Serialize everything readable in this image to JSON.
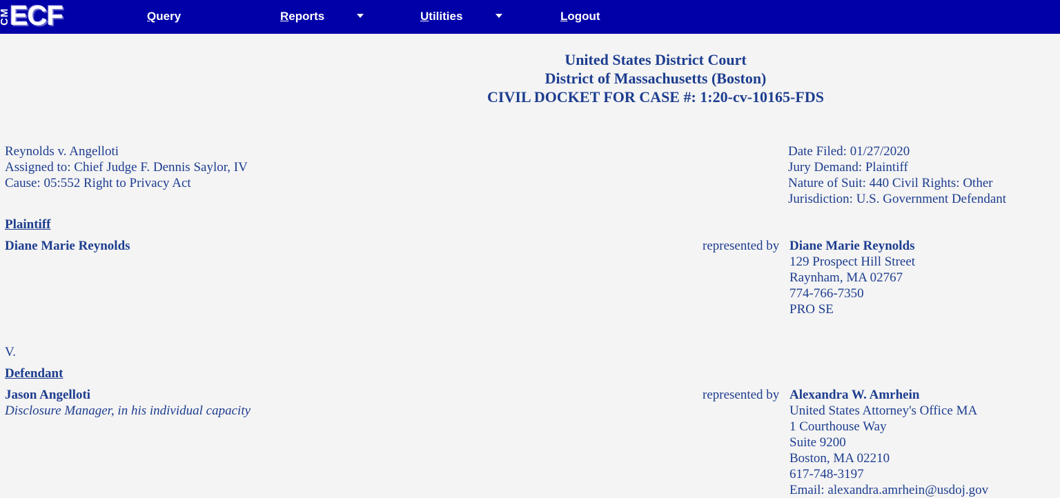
{
  "nav": {
    "logo_cm": "CM",
    "logo_ecf": "ECF",
    "items": [
      {
        "label_first": "Q",
        "label_rest": "uery",
        "has_menu": false
      },
      {
        "label_first": "R",
        "label_rest": "eports",
        "has_menu": true
      },
      {
        "label_first": "U",
        "label_rest": "tilities",
        "has_menu": true
      },
      {
        "label_first": "L",
        "label_rest": "ogout",
        "has_menu": false
      }
    ]
  },
  "header": {
    "court": "United States District Court",
    "district": "District of Massachusetts (Boston)",
    "docket": "CIVIL DOCKET FOR CASE #: 1:20-cv-10165-FDS"
  },
  "case": {
    "title": "Reynolds v. Angelloti",
    "assigned": "Assigned to: Chief Judge F. Dennis Saylor, IV",
    "cause": "Cause: 05:552 Right to Privacy Act",
    "date_filed": "Date Filed: 01/27/2020",
    "jury_demand": "Jury Demand: Plaintiff",
    "nature_of_suit": "Nature of Suit: 440 Civil Rights: Other",
    "jurisdiction": "Jurisdiction: U.S. Government Defendant"
  },
  "plaintiff": {
    "heading": "Plaintiff",
    "name": "Diane Marie Reynolds",
    "represented_by": "represented by",
    "counsel": {
      "name": "Diane Marie Reynolds",
      "lines": [
        "129 Prospect Hill Street",
        "Raynham, MA 02767",
        "774-766-7350",
        "PRO SE"
      ]
    }
  },
  "versus": "V.",
  "defendant": {
    "heading": "Defendant",
    "name": "Jason Angelloti",
    "role": "Disclosure Manager, in his individual capacity",
    "represented_by": "represented by",
    "counsel": {
      "name": "Alexandra W. Amrhein",
      "lines": [
        "United States Attorney's Office MA",
        "1 Courthouse Way",
        "Suite 9200",
        "Boston, MA 02210",
        "617-748-3197",
        "Email: alexandra.amrhein@usdoj.gov"
      ]
    }
  }
}
